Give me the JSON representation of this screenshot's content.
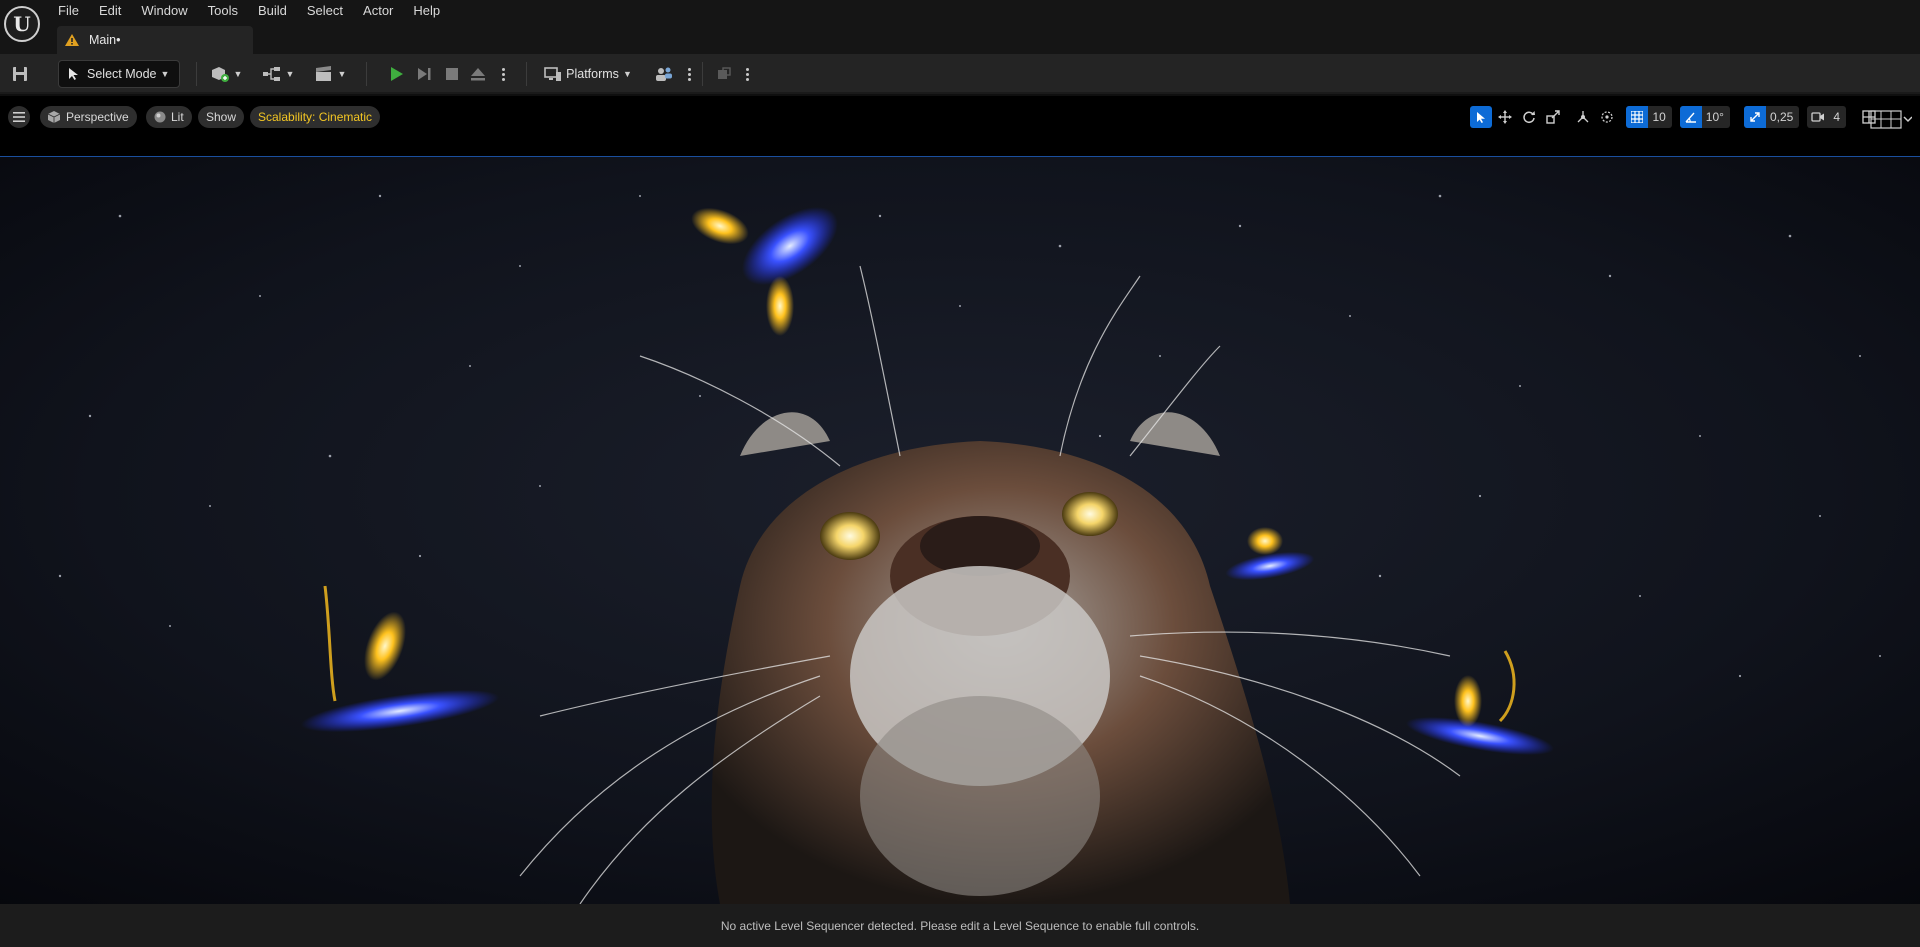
{
  "app": {
    "logo_letter": "U",
    "accent_color": "#0d6bd6"
  },
  "menu": {
    "items": [
      {
        "label": "File"
      },
      {
        "label": "Edit"
      },
      {
        "label": "Window"
      },
      {
        "label": "Tools"
      },
      {
        "label": "Build"
      },
      {
        "label": "Select"
      },
      {
        "label": "Actor"
      },
      {
        "label": "Help"
      }
    ]
  },
  "tab": {
    "label": "Main•",
    "icon": "level-warning-icon"
  },
  "toolbar": {
    "select_mode_label": "Select Mode",
    "platforms_label": "Platforms",
    "play_color": "#3fae3f"
  },
  "viewport": {
    "perspective_label": "Perspective",
    "lit_label": "Lit",
    "show_label": "Show",
    "scalability_label": "Scalability: Cinematic",
    "scalability_color": "#f3c623",
    "grid_snap_value": "10",
    "rotation_snap_value": "10°",
    "scale_snap_value": "0,25",
    "camera_speed_value": "4"
  },
  "status": {
    "message": "No active Level Sequencer detected. Please edit a Level Sequence to enable full controls."
  }
}
